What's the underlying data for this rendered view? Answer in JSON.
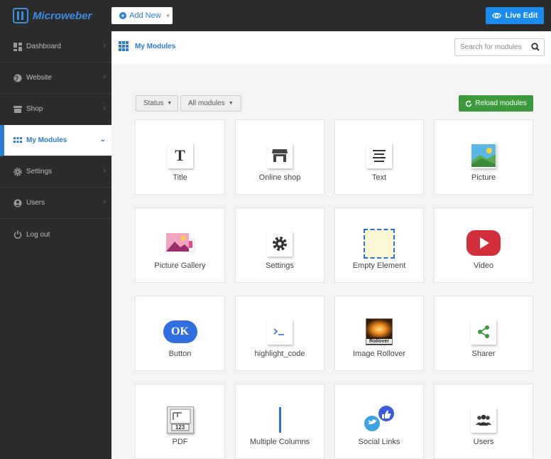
{
  "app": {
    "logo_text": "Microweber",
    "add_new_label": "Add New",
    "live_edit_label": "Live Edit"
  },
  "sidebar": {
    "items": [
      {
        "label": "Dashboard",
        "icon": "dashboard-icon"
      },
      {
        "label": "Website",
        "icon": "globe-icon"
      },
      {
        "label": "Shop",
        "icon": "shop-icon"
      },
      {
        "label": "My Modules",
        "icon": "modules-grid-icon",
        "active": true
      },
      {
        "label": "Settings",
        "icon": "gear-icon"
      },
      {
        "label": "Users",
        "icon": "user-icon"
      },
      {
        "label": "Log out",
        "icon": "power-icon"
      }
    ]
  },
  "header": {
    "title": "My Modules",
    "search_placeholder": "Search for modules"
  },
  "filters": {
    "status_label": "Status",
    "modules_label": "All modules",
    "reload_label": "Reload modules"
  },
  "modules": [
    {
      "label": "Title",
      "icon": "title-icon"
    },
    {
      "label": "Online shop",
      "icon": "online-shop-icon"
    },
    {
      "label": "Text",
      "icon": "text-icon"
    },
    {
      "label": "Picture",
      "icon": "picture-icon"
    },
    {
      "label": "Picture Gallery",
      "icon": "picture-gallery-icon"
    },
    {
      "label": "Settings",
      "icon": "settings-gear-icon"
    },
    {
      "label": "Empty Element",
      "icon": "empty-element-icon"
    },
    {
      "label": "Video",
      "icon": "video-play-icon"
    },
    {
      "label": "Button",
      "icon": "ok-button-icon",
      "icon_text": "OK"
    },
    {
      "label": "highlight_code",
      "icon": "code-prompt-icon"
    },
    {
      "label": "Image Rollover",
      "icon": "image-rollover-icon",
      "icon_text": "Rollover"
    },
    {
      "label": "Sharer",
      "icon": "share-icon"
    },
    {
      "label": "PDF",
      "icon": "pdf-icon",
      "icon_text": "123"
    },
    {
      "label": "Multiple Columns",
      "icon": "columns-icon"
    },
    {
      "label": "Social Links",
      "icon": "social-links-icon"
    },
    {
      "label": "Users",
      "icon": "users-group-icon"
    }
  ],
  "colors": {
    "accent": "#2b7cd3",
    "live_edit": "#1a8cf0",
    "reload": "#3c9a3c",
    "sidebar_bg": "#2b2b2b"
  }
}
